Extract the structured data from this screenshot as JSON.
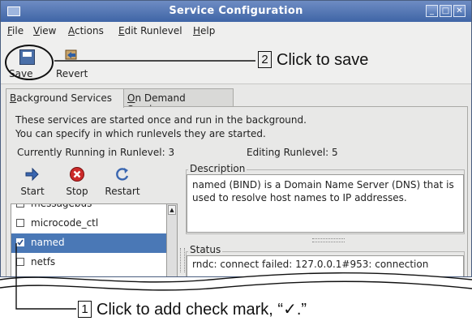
{
  "window": {
    "title": "Service Configuration"
  },
  "menu": [
    {
      "label": "File",
      "u": "F",
      "rest": "ile"
    },
    {
      "label": "View",
      "u": "V",
      "rest": "iew"
    },
    {
      "label": "Actions",
      "u": "A",
      "rest": "ctions"
    },
    {
      "label": "Edit Runlevel",
      "u": "E",
      "rest": "dit Runlevel"
    },
    {
      "label": "Help",
      "u": "H",
      "rest": "elp"
    }
  ],
  "toolbar": {
    "save_label": "Save",
    "revert_label": "Revert"
  },
  "tabs": [
    {
      "label": "Background Services",
      "u": "B",
      "rest": "ackground Services",
      "active": true
    },
    {
      "label": "On Demand Services",
      "u": "O",
      "rest": "n Demand Services",
      "active": false
    }
  ],
  "panel": {
    "intro_line1": "These services are started once and run in the background.",
    "intro_line2": "You can specify in which runlevels they are started.",
    "running_runlevel": "Currently Running in Runlevel: 3",
    "editing_runlevel": "Editing Runlevel: 5"
  },
  "service_buttons": {
    "start": "Start",
    "stop": "Stop",
    "restart": "Restart"
  },
  "services": [
    {
      "name": "messagebus",
      "checked": false,
      "selected": false
    },
    {
      "name": "microcode_ctl",
      "checked": false,
      "selected": false
    },
    {
      "name": "named",
      "checked": true,
      "selected": true
    },
    {
      "name": "netfs",
      "checked": false,
      "selected": false
    }
  ],
  "description": {
    "legend": "Description",
    "text": "named (BIND) is a Domain Name Server (DNS) that is used to resolve host names to IP addresses."
  },
  "status": {
    "legend": "Status",
    "text": "rndc: connect failed: 127.0.0.1#953: connection"
  },
  "callouts": {
    "save": {
      "number": "2",
      "text": "Click to save"
    },
    "check": {
      "number": "1",
      "text": "Click to add check mark, “✓.”"
    }
  },
  "colors": {
    "titlebar": "#4f73b3",
    "selection": "#4a78b6",
    "stop_icon": "#cc2a2a"
  }
}
